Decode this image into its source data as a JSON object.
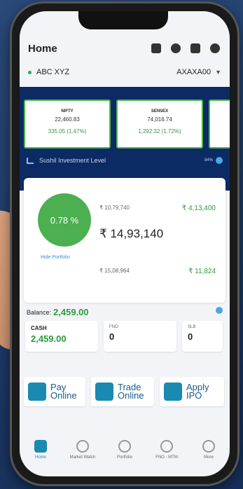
{
  "header": {
    "title": "Home"
  },
  "account": {
    "name": "ABC XYZ",
    "code": "AXAXA00"
  },
  "indices": {
    "cards": [
      {
        "name": "NIFTY",
        "value": "22,460.83",
        "change": "335.05 (1.47%)"
      },
      {
        "name": "SENSEX",
        "value": "74,016.74",
        "change": "1,292.32 (1.72%)"
      }
    ]
  },
  "investment": {
    "label": "Sushil Investment Level",
    "pct": "84%"
  },
  "portfolio": {
    "percent": "0.78 %",
    "hide_label": "Hide Portfolio",
    "v1": "₹ 10,79,740",
    "g1": "₹ 4,13,400",
    "current_value": "₹ 14,93,140",
    "v2": "₹ 15,08,964",
    "g2": "₹ 11,824"
  },
  "balance": {
    "label": "Balance:",
    "value": "2,459.00"
  },
  "segments": [
    {
      "label": "CASH",
      "value": "2,459.00"
    },
    {
      "label": "FNO",
      "value": "0"
    },
    {
      "label": "SLB",
      "value": "0"
    }
  ],
  "actions": [
    {
      "l1": "Pay",
      "l2": "Online"
    },
    {
      "l1": "Trade",
      "l2": "Online"
    },
    {
      "l1": "Apply",
      "l2": "IPO"
    }
  ],
  "nav": [
    {
      "label": "Home"
    },
    {
      "label": "Market Watch"
    },
    {
      "label": "Portfolio"
    },
    {
      "label": "FNO - MTM"
    },
    {
      "label": "More"
    }
  ]
}
